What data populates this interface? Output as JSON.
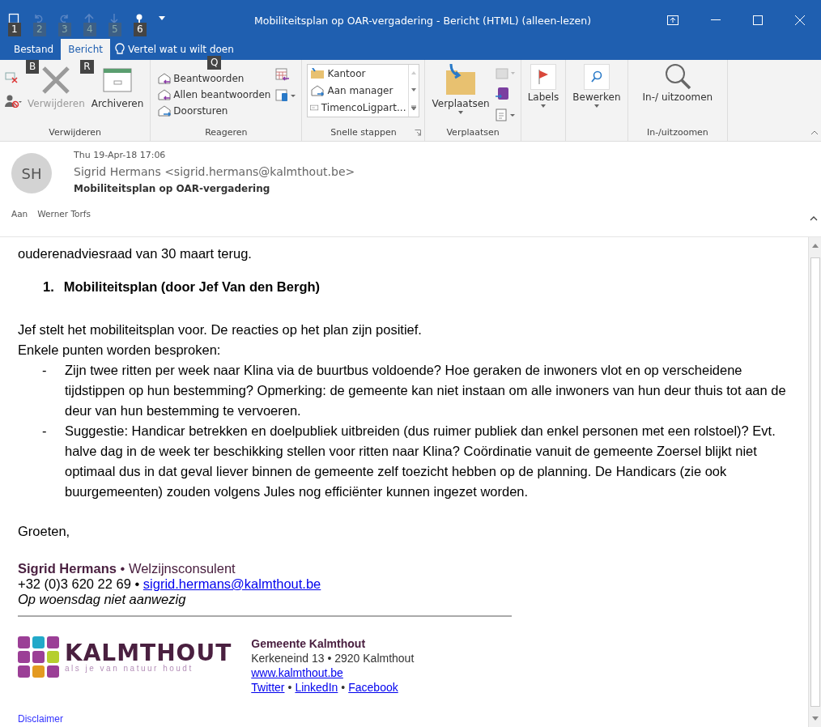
{
  "window": {
    "title": "Mobiliteitsplan op OAR-vergadering  -  Bericht (HTML) (alleen-lezen)"
  },
  "quick_access": [
    {
      "keytip": "1",
      "disabled": false
    },
    {
      "keytip": "2",
      "disabled": true
    },
    {
      "keytip": "3",
      "disabled": true
    },
    {
      "keytip": "4",
      "disabled": true
    },
    {
      "keytip": "5",
      "disabled": true
    },
    {
      "keytip": "6",
      "disabled": false
    }
  ],
  "tabs": [
    {
      "label": "Bestand",
      "selected": false,
      "keytip": "B"
    },
    {
      "label": "Bericht",
      "selected": true,
      "keytip": "R"
    }
  ],
  "tell_me": {
    "placeholder": "Vertel wat u wilt doen",
    "keytip": "Q"
  },
  "ribbon": [
    {
      "kind": "delete",
      "label": "Verwijderen",
      "buttons": [
        {
          "label": "Verwijderen",
          "disabled": true
        },
        {
          "label": "Archiveren",
          "disabled": false
        }
      ]
    },
    {
      "kind": "respond",
      "label": "Reageren",
      "buttons": [
        {
          "label": "Beantwoorden"
        },
        {
          "label": "Allen beantwoorden"
        },
        {
          "label": "Doorsturen"
        }
      ]
    },
    {
      "kind": "quicksteps",
      "label": "Snelle stappen",
      "buttons": [
        {
          "label": "Kantoor"
        },
        {
          "label": "Aan manager"
        },
        {
          "label": "TimencoLigpart..."
        }
      ]
    },
    {
      "kind": "move",
      "label": "Verplaatsen",
      "buttons": [
        {
          "label": "Verplaatsen"
        }
      ]
    },
    {
      "kind": "tags",
      "buttons": [
        {
          "label": "Labels"
        }
      ]
    },
    {
      "kind": "edit",
      "buttons": [
        {
          "label": "Bewerken"
        }
      ]
    },
    {
      "kind": "zoom",
      "label": "In-/uitzoomen",
      "buttons": [
        {
          "label": "In-/ uitzoomen"
        }
      ]
    }
  ],
  "message": {
    "initials": "SH",
    "date": "Thu 19-Apr-18 17:06",
    "from": "Sigrid Hermans <sigrid.hermans@kalmthout.be>",
    "subject": "Mobiliteitsplan op OAR-vergadering",
    "to_label": "Aan",
    "to": "Werner Torfs"
  },
  "body": {
    "intro": "ouderenadviesraad van 30 maart terug.",
    "heading_number": "1.",
    "heading": "Mobiliteitsplan (door Jef Van den Bergh)",
    "paragraphs": [
      "Jef stelt het mobiliteitsplan voor. De reacties op het plan zijn positief.",
      "Enkele punten worden besproken:"
    ],
    "bullets": [
      {
        "marker": "-",
        "text": "Zijn twee ritten per week naar Klina via de buurtbus voldoende? Hoe geraken de inwoners vlot en op verscheidene tijdstippen op hun bestemming? Opmerking: de gemeente kan niet instaan om alle inwoners van hun deur thuis tot aan de deur van hun bestemming te vervoeren."
      },
      {
        "marker": "-",
        "text": "Suggestie: Handicar betrekken en doelpubliek uitbreiden (dus ruimer publiek dan enkel personen met een rolstoel)? Evt. halve dag in de week ter beschikking stellen voor ritten naar Klina? Coördinatie vanuit de gemeente Zoersel blijkt niet optimaal dus in dat geval liever binnen de gemeente zelf toezicht hebben op de planning. De Handicars (zie ook buurgemeenten) zouden volgens Jules nog efficiënter kunnen ingezet worden."
      }
    ],
    "closing": "Groeten,"
  },
  "signature": {
    "line1": "**Sigrid Hermans** • Welzijnsconsulent",
    "phone": "+32 (0)3 620 22 69 •",
    "email": "sigrid.hermans@kalmthout.be",
    "note": "Op woensdag niet aanwezig"
  },
  "organisation": {
    "logo_name": "KALMTHOUT",
    "logo_tagline": "als je van natuur houdt",
    "name": "Gemeente Kalmthout",
    "address": "Kerkeneind 13 • 2920 Kalmthout",
    "website": "www.kalmthout.be",
    "social": [
      "Twitter",
      "LinkedIn",
      "Facebook"
    ],
    "separator": "•"
  },
  "disclaimer": "Disclaimer"
}
